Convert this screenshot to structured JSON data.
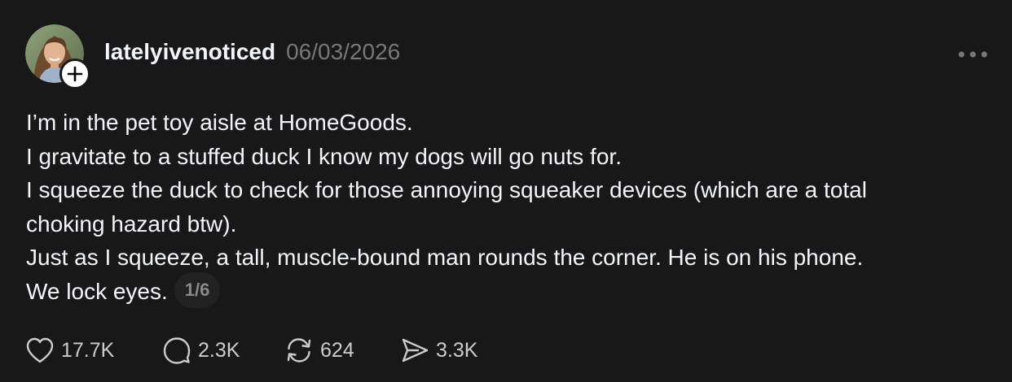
{
  "post": {
    "username": "latelyivenoticed",
    "timestamp": "06/03/2026",
    "lines": [
      "I’m in the pet toy aisle at HomeGoods.",
      "I gravitate to a stuffed duck I know my dogs will go nuts for.",
      "I squeeze the duck to check for those annoying squeaker devices (which are a total",
      "choking hazard btw).",
      "Just as I squeeze, a tall, muscle-bound man rounds the corner. He is on his phone.",
      "We lock eyes."
    ],
    "page_indicator": "1/6"
  },
  "actions": {
    "likes": "17.7K",
    "replies": "2.3K",
    "reposts": "624",
    "shares": "3.3K"
  },
  "icons": {
    "avatar": "profile-photo",
    "follow": "plus-icon",
    "more": "more-horizontal-icon",
    "like": "heart-icon",
    "reply": "comment-bubble-icon",
    "repost": "repost-icon",
    "share": "send-icon"
  },
  "colors": {
    "background": "#181818",
    "text": "#f3f5f7",
    "muted": "#777777",
    "pill_bg": "#222222"
  }
}
